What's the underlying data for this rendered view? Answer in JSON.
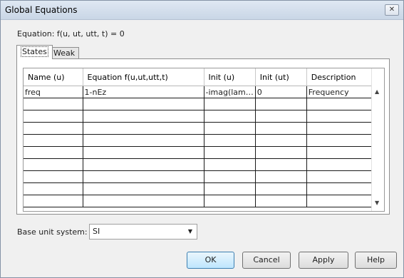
{
  "window": {
    "title": "Global Equations",
    "close_glyph": "✕"
  },
  "equation_text": "Equation: f(u, ut, utt, t) = 0",
  "tabs": [
    {
      "label": "States"
    },
    {
      "label": "Weak"
    }
  ],
  "table": {
    "columns": [
      "Name (u)",
      "Equation f(u,ut,utt,t)",
      "Init (u)",
      "Init (ut)",
      "Description"
    ],
    "rows": [
      [
        "freq",
        "1-nEz",
        "-imag(lam…",
        "0",
        "Frequency"
      ],
      [
        "",
        "",
        "",
        "",
        ""
      ],
      [
        "",
        "",
        "",
        "",
        ""
      ],
      [
        "",
        "",
        "",
        "",
        ""
      ],
      [
        "",
        "",
        "",
        "",
        ""
      ],
      [
        "",
        "",
        "",
        "",
        ""
      ],
      [
        "",
        "",
        "",
        "",
        ""
      ],
      [
        "",
        "",
        "",
        "",
        ""
      ],
      [
        "",
        "",
        "",
        "",
        ""
      ],
      [
        "",
        "",
        "",
        "",
        ""
      ]
    ]
  },
  "base_unit_system": {
    "label": "Base unit system:",
    "value": "SI"
  },
  "buttons": {
    "ok": "OK",
    "cancel": "Cancel",
    "apply": "Apply",
    "help": "Help"
  },
  "icons": {
    "scroll_up": "triangle-up-icon",
    "scroll_down": "triangle-down-icon",
    "dropdown": "chevron-down-icon"
  }
}
